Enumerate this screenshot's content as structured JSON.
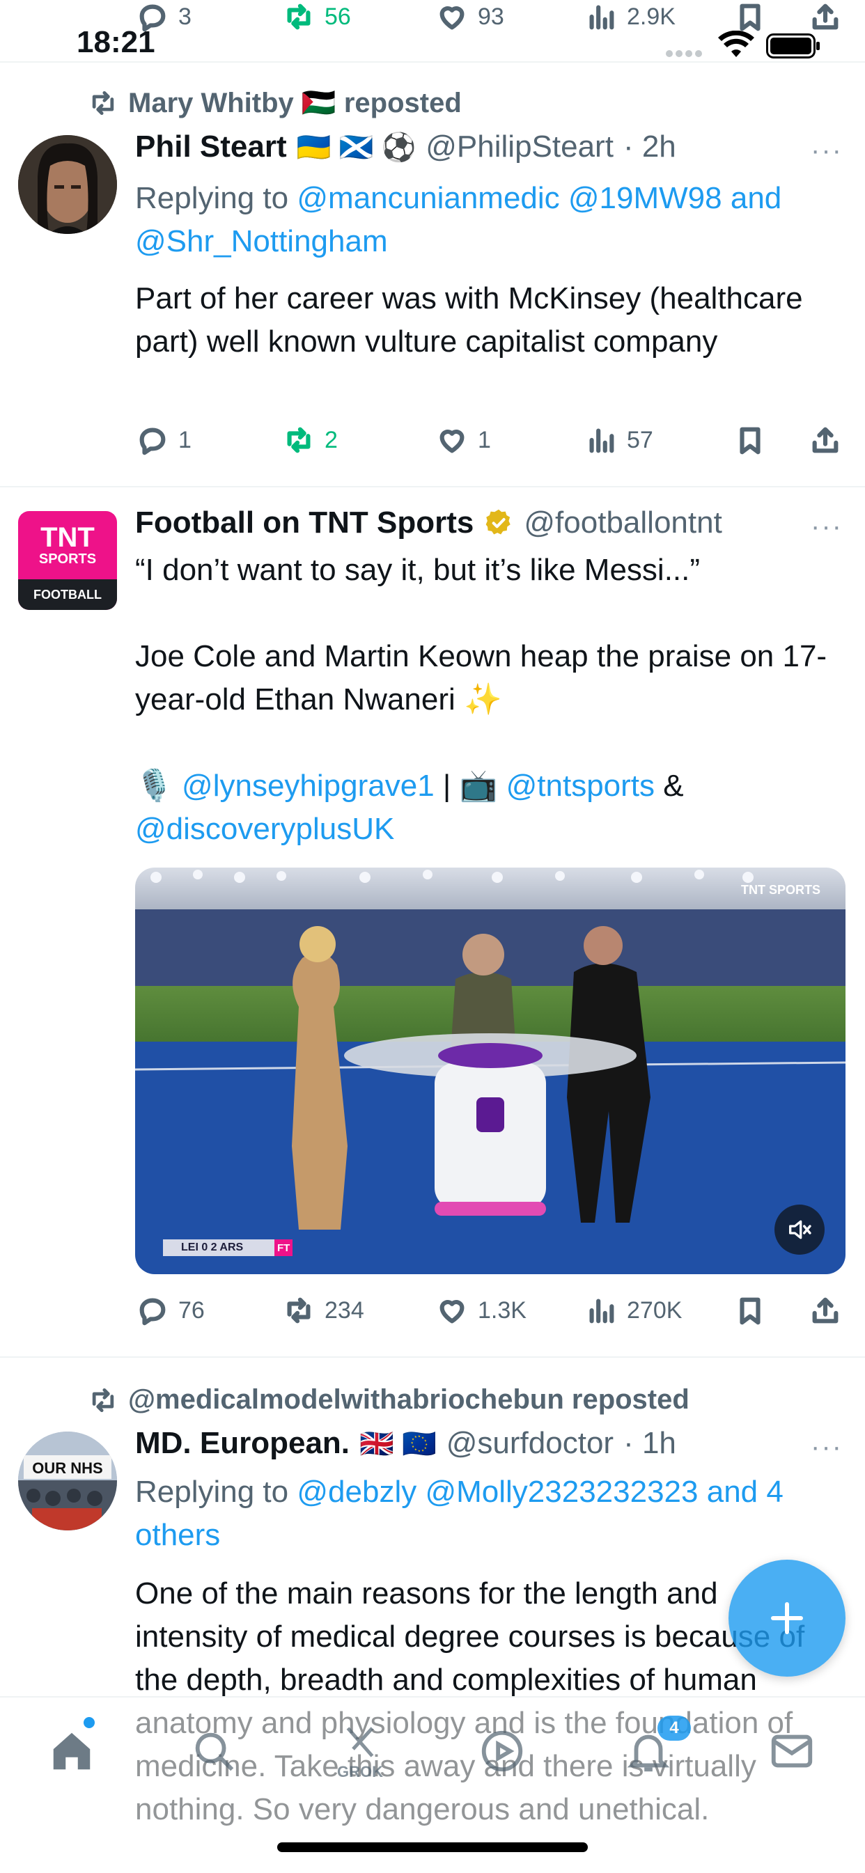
{
  "status_bar": {
    "time": "18:21"
  },
  "top_actions": {
    "replies": "3",
    "reposts": "56",
    "likes": "93",
    "views": "2.9K"
  },
  "tweets": [
    {
      "repost_label": "Mary Whitby 🇵🇸 reposted",
      "name": "Phil Steart",
      "name_emoji": "🇺🇦 🏴󠁧󠁢󠁳󠁣󠁴󠁿 ⚽",
      "handle": "@PhilipSteart",
      "time": "· 2h",
      "reply_prefix": "Replying to",
      "reply_to": "@mancunianmedic @19MW98 and @Shr_Nottingham",
      "text": "Part of her career was with McKinsey (healthcare part)  well known vulture capitalist company",
      "replies": "1",
      "reposts": "2",
      "likes": "1",
      "views": "57"
    },
    {
      "name": "Football on TNT Sports",
      "handle": "@footballontnt",
      "avatar_lines": [
        "TNT",
        "SPORTS",
        "FOOTBALL"
      ],
      "text_line1": "“I don’t want to say it, but it’s like Messi...”",
      "text_line2": "Joe Cole and Martin Keown heap the praise on 17-year-old Ethan Nwaneri ✨",
      "mention1": "@lynseyhipgrave1",
      "sep": "|",
      "mention2": "@tntsports",
      "amp": "&",
      "mention3": "@discoveryplusUK",
      "video_score": "LEI 0  2 ARS",
      "video_ft": "FT",
      "video_brand": "TNT SPORTS",
      "replies": "76",
      "reposts": "234",
      "likes": "1.3K",
      "views": "270K"
    },
    {
      "repost_label": "@medicalmodelwithabriochebun reposted",
      "name": "MD. European.",
      "name_emoji": "🇬🇧 🇪🇺",
      "handle": "@surfdoctor",
      "time": "· 1h",
      "avatar_text": "OUR NHS",
      "reply_prefix": "Replying to",
      "reply_to": "@debzly @Molly2323232323 and 4 others",
      "text": "One of the main reasons for the length and intensity of medical degree courses is because of the depth, breadth and complexities of human anatomy and physiology and is the foundation of medicine. Take this away and there is virtually nothing.  So very dangerous and unethical."
    }
  ],
  "bottom_nav": {
    "grok_label": "GROK",
    "notifications_count": "4"
  },
  "colors": {
    "link": "#1d9bf0",
    "repost_green": "#00ba7c",
    "muted": "#536471",
    "fab": "#1d9bf0"
  }
}
